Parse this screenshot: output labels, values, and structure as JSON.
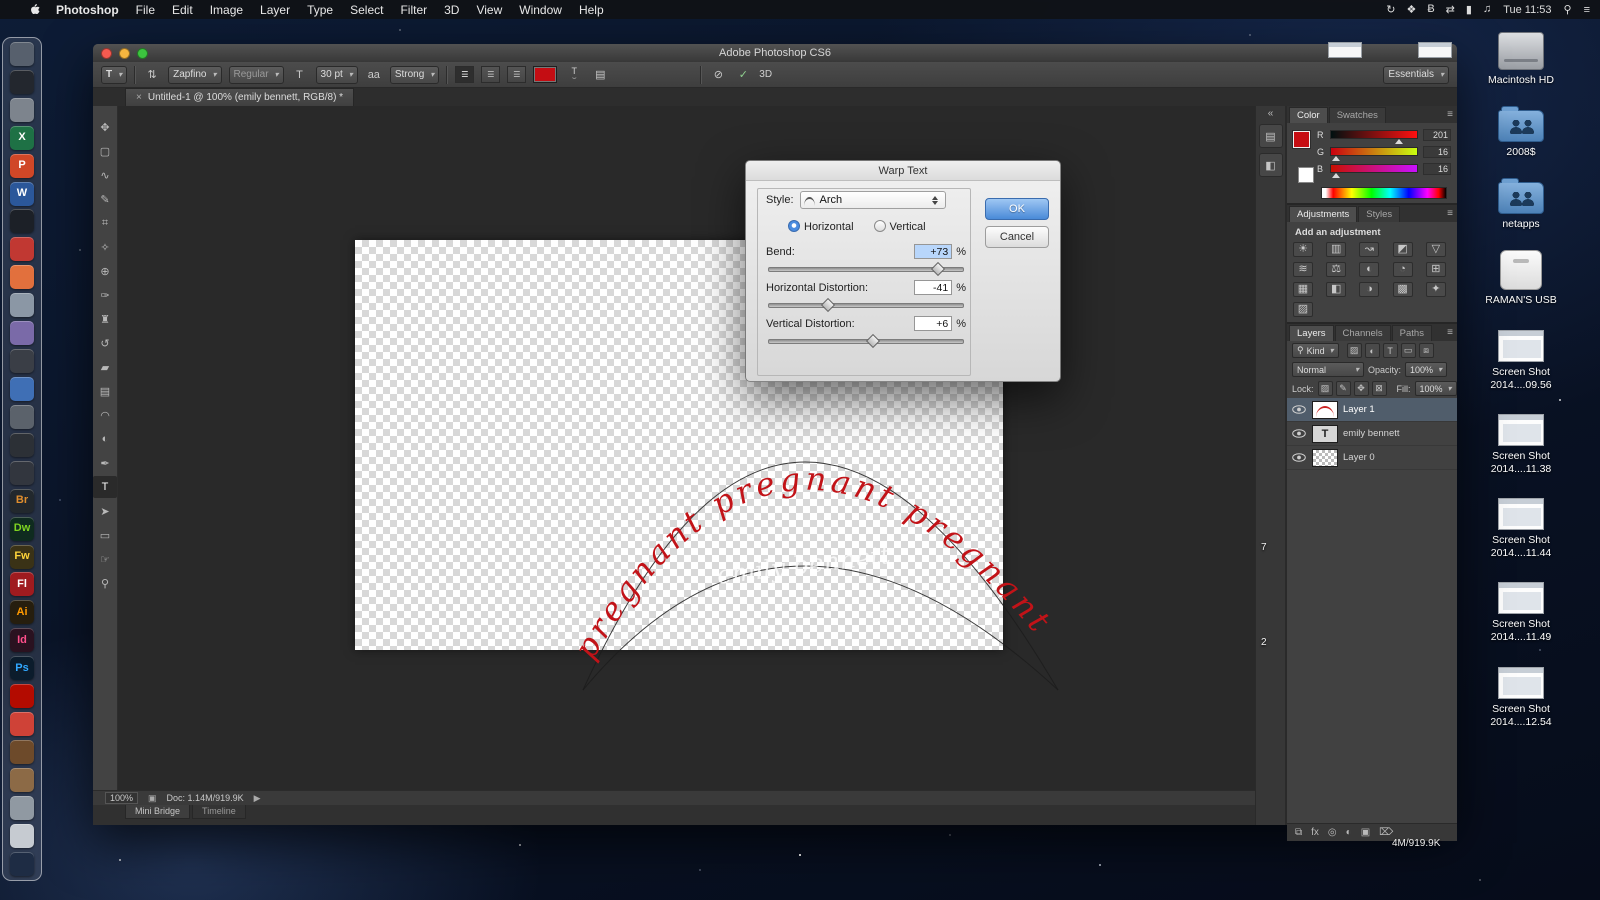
{
  "icons": {
    "chevron": "▾",
    "search": "⚲",
    "menu": "≡",
    "close": "×",
    "collapse": "«",
    "play": "▶",
    "doc_icon": "▣"
  },
  "menu_bar": {
    "items": [
      "Photoshop",
      "File",
      "Edit",
      "Image",
      "Layer",
      "Type",
      "Select",
      "Filter",
      "3D",
      "View",
      "Window",
      "Help"
    ],
    "status_icons": [
      "↻",
      "❖",
      "Ƀ",
      "⇄",
      "▮",
      "♫"
    ],
    "clock": "Tue 11:53"
  },
  "dock": {
    "items": [
      {
        "name": "app-grid",
        "bg": "#57606d",
        "label": "",
        "fg": "#fff"
      },
      {
        "name": "app-dark",
        "bg": "#23272e",
        "label": "",
        "fg": "#fff"
      },
      {
        "name": "app-photo",
        "bg": "#7d848d",
        "label": "",
        "fg": "#fff"
      },
      {
        "name": "excel",
        "bg": "#1e7145",
        "label": "X",
        "fg": "#ffffff"
      },
      {
        "name": "powerpoint",
        "bg": "#d04727",
        "label": "P",
        "fg": "#ffffff"
      },
      {
        "name": "word",
        "bg": "#2b579a",
        "label": "W",
        "fg": "#ffffff"
      },
      {
        "name": "app-round-dark",
        "bg": "#1c2027",
        "label": "",
        "fg": "#fff"
      },
      {
        "name": "app-red",
        "bg": "#c13832",
        "label": "",
        "fg": "#fff"
      },
      {
        "name": "app-orange",
        "bg": "#e2703d",
        "label": "",
        "fg": "#fff"
      },
      {
        "name": "app-slate",
        "bg": "#8b97a5",
        "label": "",
        "fg": "#fff"
      },
      {
        "name": "app-violet",
        "bg": "#7a6aa8",
        "label": "",
        "fg": "#fff"
      },
      {
        "name": "app-graphite",
        "bg": "#3a3e46",
        "label": "",
        "fg": "#fff"
      },
      {
        "name": "app-blue",
        "bg": "#3f6fb5",
        "label": "",
        "fg": "#fff"
      },
      {
        "name": "app-steel",
        "bg": "#5b626b",
        "label": "",
        "fg": "#fff"
      },
      {
        "name": "app-dots",
        "bg": "#2c3036",
        "label": "",
        "fg": "#fff"
      },
      {
        "name": "app-charcoal",
        "bg": "#32363e",
        "label": "",
        "fg": "#fff"
      },
      {
        "name": "bridge",
        "bg": "#22282d",
        "label": "Br",
        "fg": "#e08e2e"
      },
      {
        "name": "dreamweaver",
        "bg": "#0f2b1f",
        "label": "Dw",
        "fg": "#7ed321"
      },
      {
        "name": "fireworks",
        "bg": "#3a3216",
        "label": "Fw",
        "fg": "#ffd43a"
      },
      {
        "name": "flash",
        "bg": "#9f1b1f",
        "label": "Fl",
        "fg": "#ffffff"
      },
      {
        "name": "illustrator",
        "bg": "#261e0e",
        "label": "Ai",
        "fg": "#ff9a00"
      },
      {
        "name": "indesign",
        "bg": "#2a1220",
        "label": "Id",
        "fg": "#ff4f8b"
      },
      {
        "name": "photoshop",
        "bg": "#0c1c2c",
        "label": "Ps",
        "fg": "#31a8ff"
      },
      {
        "name": "acrobat",
        "bg": "#b30b00",
        "label": "",
        "fg": "#fff"
      },
      {
        "name": "app-red-2",
        "bg": "#cf4237",
        "label": "",
        "fg": "#fff"
      },
      {
        "name": "app-brown",
        "bg": "#6d4a2a",
        "label": "",
        "fg": "#fff"
      },
      {
        "name": "app-tan",
        "bg": "#8c6a46",
        "label": "",
        "fg": "#fff"
      },
      {
        "name": "app-gray",
        "bg": "#9099a2",
        "label": "",
        "fg": "#fff"
      },
      {
        "name": "app-light",
        "bg": "#c6cbd1",
        "label": "",
        "fg": "#333"
      },
      {
        "name": "app-navy",
        "bg": "#1e2c44",
        "label": "",
        "fg": "#fff"
      }
    ]
  },
  "window": {
    "title": "Adobe Photoshop CS6",
    "doc_tab": "Untitled-1 @ 100% (emily bennett, RGB/8) *",
    "options": {
      "tool_preset": "T",
      "orientation_icon": "⇅",
      "font_family": "Zapfino",
      "font_style": "Regular",
      "size_icon": "T",
      "font_size": "30 pt",
      "aa_icon": "aa",
      "anti_alias": "Strong",
      "align_left": "☰",
      "align_center": "☰",
      "align_right": "☰",
      "warp_icon_top": "T",
      "warp_icon_arc": "⌣",
      "panel_toggle_icon": "▤",
      "cancel_icon": "⊘",
      "commit_icon": "✓",
      "three_d": "3D",
      "workspace": "Essentials"
    },
    "tools": [
      {
        "name": "move-tool",
        "glyph": "✥",
        "selected": ""
      },
      {
        "name": "marquee-tool",
        "glyph": "▢",
        "selected": ""
      },
      {
        "name": "lasso-tool",
        "glyph": "∿",
        "selected": ""
      },
      {
        "name": "quick-selection-tool",
        "glyph": "✎",
        "selected": ""
      },
      {
        "name": "crop-tool",
        "glyph": "⌗",
        "selected": ""
      },
      {
        "name": "eyedropper-tool",
        "glyph": "✧",
        "selected": ""
      },
      {
        "name": "healing-brush-tool",
        "glyph": "⊕",
        "selected": ""
      },
      {
        "name": "brush-tool",
        "glyph": "✑",
        "selected": ""
      },
      {
        "name": "clone-stamp-tool",
        "glyph": "♜",
        "selected": ""
      },
      {
        "name": "history-brush-tool",
        "glyph": "↺",
        "selected": ""
      },
      {
        "name": "eraser-tool",
        "glyph": "▰",
        "selected": ""
      },
      {
        "name": "gradient-tool",
        "glyph": "▤",
        "selected": ""
      },
      {
        "name": "blur-tool",
        "glyph": "◠",
        "selected": ""
      },
      {
        "name": "dodge-tool",
        "glyph": "◐",
        "selected": ""
      },
      {
        "name": "pen-tool",
        "glyph": "✒",
        "selected": ""
      },
      {
        "name": "type-tool",
        "glyph": "T",
        "selected": "selected"
      },
      {
        "name": "path-selection-tool",
        "glyph": "➤",
        "selected": ""
      },
      {
        "name": "shape-tool",
        "glyph": "▭",
        "selected": ""
      },
      {
        "name": "hand-tool",
        "glyph": "☞",
        "selected": ""
      },
      {
        "name": "zoom-tool",
        "glyph": "⚲",
        "selected": ""
      }
    ],
    "tool_extras": [
      "◎",
      "▯"
    ],
    "status_bar": {
      "zoom": "100%",
      "doc_info": "Doc: 1.14M/919.9K"
    },
    "bottom_tabs": [
      "Mini Bridge",
      "Timeline"
    ]
  },
  "canvas": {
    "warp_text": "pregnant pregnant pregnant",
    "ghost_text": "emily bennett"
  },
  "warp_dialog": {
    "title": "Warp Text",
    "style_label": "Style:",
    "style_value": "Arch",
    "horizontal_label": "Horizontal",
    "vertical_label": "Vertical",
    "fields": [
      {
        "label": "Bend:",
        "value": "+73",
        "unit": "%",
        "pos": "86%",
        "sel": "sel"
      },
      {
        "label": "Horizontal Distortion:",
        "value": "-41",
        "unit": "%",
        "pos": "30%",
        "sel": ""
      },
      {
        "label": "Vertical Distortion:",
        "value": "+6",
        "unit": "%",
        "pos": "53%",
        "sel": ""
      }
    ],
    "ok_label": "OK",
    "cancel_label": "Cancel"
  },
  "panels": {
    "color": {
      "tab_color": "Color",
      "tab_swatches": "Swatches",
      "channels": [
        {
          "label": "R",
          "value": "201",
          "pos": "79%"
        },
        {
          "label": "G",
          "value": "16",
          "pos": "6%"
        },
        {
          "label": "B",
          "value": "16",
          "pos": "6%"
        }
      ]
    },
    "adjustments": {
      "tab_adjustments": "Adjustments",
      "tab_styles": "Styles",
      "hint": "Add an adjustment",
      "icons": [
        "☀",
        "▥",
        "↝",
        "◩",
        "▽",
        "≋",
        "⚖",
        "◐",
        "◔",
        "⊞",
        "▦",
        "◧",
        "◑",
        "▩",
        "✦",
        "▨"
      ]
    },
    "layers": {
      "tab_layers": "Layers",
      "tab_channels": "Channels",
      "tab_paths": "Paths",
      "kind": "Kind",
      "filter_icons": [
        "▨",
        "◐",
        "T",
        "▭",
        "⧈"
      ],
      "blend": "Normal",
      "opacity_label": "Opacity:",
      "opacity": "100%",
      "lock_label": "Lock:",
      "lock_icons": [
        "▨",
        "✎",
        "✥",
        "⊠"
      ],
      "fill_label": "Fill:",
      "fill": "100%",
      "rows": [
        {
          "name": "Layer 1",
          "type": "warp",
          "selected": "selected"
        },
        {
          "name": "emily bennett",
          "type": "text",
          "selected": ""
        },
        {
          "name": "Layer 0",
          "type": "checker",
          "selected": ""
        }
      ],
      "footer_icons": [
        "⧉",
        "fx",
        "◎",
        "◐",
        "▣",
        "⌦"
      ]
    }
  },
  "desktop": {
    "icons": [
      {
        "name": "macintosh-hd",
        "label": "Macintosh HD",
        "type": "hd"
      },
      {
        "name": "folder-2008",
        "label": "2008$",
        "type": "folder"
      },
      {
        "name": "folder-netapps",
        "label": "netapps",
        "type": "folder"
      },
      {
        "name": "ramans-usb",
        "label": "RAMAN'S USB",
        "type": "usb"
      },
      {
        "name": "screenshot-0956",
        "label": "Screen Shot 2014....09.56",
        "type": "shot"
      },
      {
        "name": "screenshot-1138",
        "label": "Screen Shot 2014....11.38",
        "type": "shot"
      },
      {
        "name": "screenshot-1144",
        "label": "Screen Shot 2014....11.44",
        "type": "shot"
      },
      {
        "name": "screenshot-1149",
        "label": "Screen Shot 2014....11.49",
        "type": "shot"
      },
      {
        "name": "screenshot-1254",
        "label": "Screen Shot 2014....12.54",
        "type": "shot"
      }
    ],
    "fragments": {
      "a": "7",
      "b": "2",
      "size_text": "4M/919.9K"
    }
  }
}
